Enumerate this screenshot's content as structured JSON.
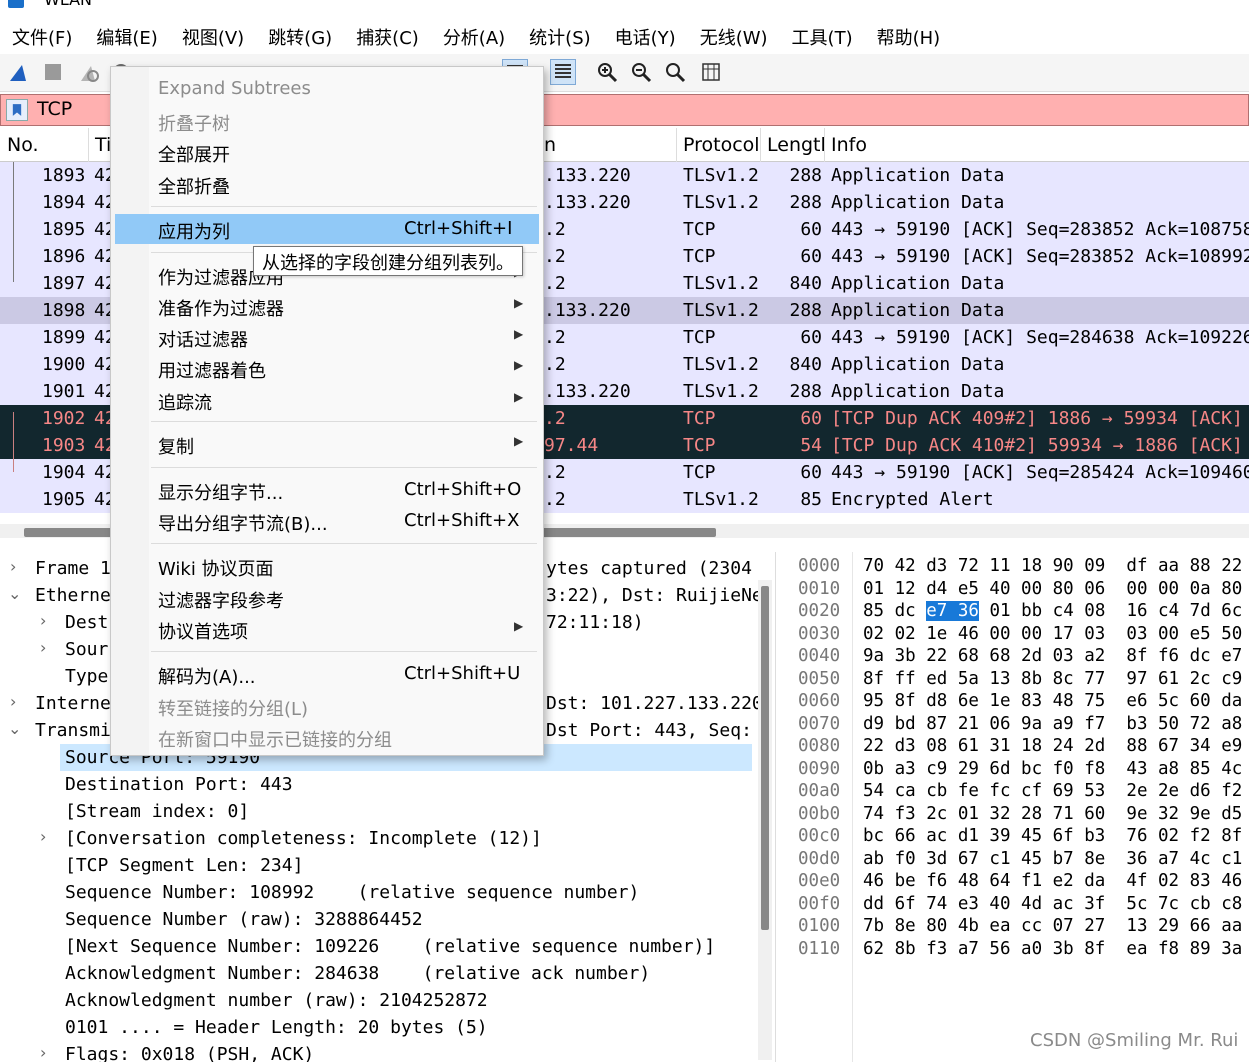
{
  "window": {
    "title": "WLAN"
  },
  "menubar": [
    "文件(F)",
    "编辑(E)",
    "视图(V)",
    "跳转(G)",
    "捕获(C)",
    "分析(A)",
    "统计(S)",
    "电话(Y)",
    "无线(W)",
    "工具(T)",
    "帮助(H)"
  ],
  "filter": {
    "value": "TCP"
  },
  "packet_list": {
    "columns": {
      "no": "No.",
      "time": "Ti",
      "destination": "n",
      "protocol": "Protocol",
      "length": "Lengtl",
      "info": "Info"
    },
    "rows": [
      {
        "no": "1893",
        "time": "42",
        "dst": ".133.220",
        "proto": "TLSv1.2",
        "len": "288",
        "info": "Application Data"
      },
      {
        "no": "1894",
        "time": "42",
        "dst": ".133.220",
        "proto": "TLSv1.2",
        "len": "288",
        "info": "Application Data"
      },
      {
        "no": "1895",
        "time": "42",
        "dst": ".2",
        "proto": "TCP",
        "len": "60",
        "info": "443 → 59190 [ACK] Seq=283852 Ack=108758"
      },
      {
        "no": "1896",
        "time": "42",
        "dst": ".2",
        "proto": "TCP",
        "len": "60",
        "info": "443 → 59190 [ACK] Seq=283852 Ack=108992"
      },
      {
        "no": "1897",
        "time": "42",
        "dst": ".2",
        "proto": "TLSv1.2",
        "len": "840",
        "info": "Application Data"
      },
      {
        "no": "1898",
        "time": "42",
        "dst": ".133.220",
        "proto": "TLSv1.2",
        "len": "288",
        "info": "Application Data"
      },
      {
        "no": "1899",
        "time": "42",
        "dst": ".2",
        "proto": "TCP",
        "len": "60",
        "info": "443 → 59190 [ACK] Seq=284638 Ack=109226"
      },
      {
        "no": "1900",
        "time": "42",
        "dst": ".2",
        "proto": "TLSv1.2",
        "len": "840",
        "info": "Application Data"
      },
      {
        "no": "1901",
        "time": "42",
        "dst": ".133.220",
        "proto": "TLSv1.2",
        "len": "288",
        "info": "Application Data"
      },
      {
        "no": "1902",
        "time": "42",
        "dst": ".2",
        "proto": "TCP",
        "len": "60",
        "info": "[TCP Dup ACK 409#2] 1886 → 59934 [ACK]"
      },
      {
        "no": "1903",
        "time": "42",
        "dst": "97.44",
        "proto": "TCP",
        "len": "54",
        "info": "[TCP Dup ACK 410#2] 59934 → 1886 [ACK]"
      },
      {
        "no": "1904",
        "time": "42",
        "dst": ".2",
        "proto": "TCP",
        "len": "60",
        "info": "443 → 59190 [ACK] Seq=285424 Ack=109460"
      },
      {
        "no": "1905",
        "time": "42",
        "dst": ".2",
        "proto": "TLSv1.2",
        "len": "85",
        "info": "Encrypted Alert"
      }
    ]
  },
  "details": [
    {
      "text": "Frame 1",
      "tail": "ytes captured (2304"
    },
    {
      "text": "Etherne",
      "tail": "3:22), Dst: RuijieNe"
    },
    {
      "text": "Dest",
      "tail": "72:11:18)"
    },
    {
      "text": "Sour",
      "tail": ""
    },
    {
      "text": "Type",
      "tail": ""
    },
    {
      "text": "Interne",
      "tail": "Dst: 101.227.133.220"
    },
    {
      "text": "Transmi",
      "tail": "Dst Port: 443, Seq:"
    },
    {
      "text": "Source Port: 59190",
      "tail": ""
    },
    {
      "text": "Destination Port: 443",
      "tail": ""
    },
    {
      "text": "[Stream index: 0]",
      "tail": ""
    },
    {
      "text": "[Conversation completeness: Incomplete (12)]",
      "tail": ""
    },
    {
      "text": "[TCP Segment Len: 234]",
      "tail": ""
    },
    {
      "text": "Sequence Number: 108992    (relative sequence number)",
      "tail": ""
    },
    {
      "text": "Sequence Number (raw): 3288864452",
      "tail": ""
    },
    {
      "text": "[Next Sequence Number: 109226    (relative sequence number)]",
      "tail": ""
    },
    {
      "text": "Acknowledgment Number: 284638    (relative ack number)",
      "tail": ""
    },
    {
      "text": "Acknowledgment number (raw): 2104252872",
      "tail": ""
    },
    {
      "text": "0101 .... = Header Length: 20 bytes (5)",
      "tail": ""
    },
    {
      "text": "Flags: 0x018 (PSH, ACK)",
      "tail": ""
    }
  ],
  "hex": [
    {
      "off": "0000",
      "b1": "70 42 d3 72 11 18 90 09",
      "b2": "df aa 88 22"
    },
    {
      "off": "0010",
      "b1": "01 12 d4 e5 40 00 80 06",
      "b2": "00 00 0a 80"
    },
    {
      "off": "0020",
      "b1": "85 dc",
      "sel": "e7 36",
      "b1b": "01 bb c4 08",
      "b2": "16 c4 7d 6c"
    },
    {
      "off": "0030",
      "b1": "02 02 1e 46 00 00 17 03",
      "b2": "03 00 e5 50"
    },
    {
      "off": "0040",
      "b1": "9a 3b 22 68 68 2d 03 a2",
      "b2": "8f f6 dc e7"
    },
    {
      "off": "0050",
      "b1": "8f ff ed 5a 13 8b 8c 77",
      "b2": "97 61 2c c9"
    },
    {
      "off": "0060",
      "b1": "95 8f d8 6e 1e 83 48 75",
      "b2": "e6 5c 60 da"
    },
    {
      "off": "0070",
      "b1": "d9 bd 87 21 06 9a a9 f7",
      "b2": "b3 50 72 a8"
    },
    {
      "off": "0080",
      "b1": "22 d3 08 61 31 18 24 2d",
      "b2": "88 67 34 e9"
    },
    {
      "off": "0090",
      "b1": "0b a3 c9 29 6d bc f0 f8",
      "b2": "43 a8 85 4c"
    },
    {
      "off": "00a0",
      "b1": "54 ca cb fe fc cf 69 53",
      "b2": "2e 2e d6 f2"
    },
    {
      "off": "00b0",
      "b1": "74 f3 2c 01 32 28 71 60",
      "b2": "9e 32 9e d5"
    },
    {
      "off": "00c0",
      "b1": "bc 66 ac d1 39 45 6f b3",
      "b2": "76 02 f2 8f"
    },
    {
      "off": "00d0",
      "b1": "ab f0 3d 67 c1 45 b7 8e",
      "b2": "36 a7 4c c1"
    },
    {
      "off": "00e0",
      "b1": "46 be f6 48 64 f1 e2 da",
      "b2": "4f 02 83 46"
    },
    {
      "off": "00f0",
      "b1": "dd 6f 74 e3 40 4d ac 3f",
      "b2": "5c 7c cb c8"
    },
    {
      "off": "0100",
      "b1": "7b 8e 80 4b ea cc 07 27",
      "b2": "13 29 66 aa"
    },
    {
      "off": "0110",
      "b1": "62 8b f3 a7 56 a0 3b 8f",
      "b2": "ea f8 89 3a"
    }
  ],
  "context_menu": {
    "items": [
      {
        "label": "Expand Subtrees",
        "shortcut": "",
        "submenu": false,
        "disabled": true
      },
      {
        "label": "折叠子树",
        "shortcut": "",
        "submenu": false,
        "disabled": true
      },
      {
        "label": "全部展开",
        "shortcut": "",
        "submenu": false,
        "disabled": false
      },
      {
        "label": "全部折叠",
        "shortcut": "",
        "submenu": false,
        "disabled": false
      },
      {
        "label": "应用为列",
        "shortcut": "Ctrl+Shift+I",
        "submenu": false,
        "disabled": false,
        "highlighted": true
      },
      {
        "label": "作为过滤器应用",
        "shortcut": "",
        "submenu": true,
        "disabled": false
      },
      {
        "label": "准备作为过滤器",
        "shortcut": "",
        "submenu": true,
        "disabled": false
      },
      {
        "label": "对话过滤器",
        "shortcut": "",
        "submenu": true,
        "disabled": false
      },
      {
        "label": "用过滤器着色",
        "shortcut": "",
        "submenu": true,
        "disabled": false
      },
      {
        "label": "追踪流",
        "shortcut": "",
        "submenu": true,
        "disabled": false
      },
      {
        "label": "复制",
        "shortcut": "",
        "submenu": true,
        "disabled": false
      },
      {
        "label": "显示分组字节...",
        "shortcut": "Ctrl+Shift+O",
        "submenu": false,
        "disabled": false
      },
      {
        "label": "导出分组字节流(B)...",
        "shortcut": "Ctrl+Shift+X",
        "submenu": false,
        "disabled": false
      },
      {
        "label": "Wiki 协议页面",
        "shortcut": "",
        "submenu": false,
        "disabled": false
      },
      {
        "label": "过滤器字段参考",
        "shortcut": "",
        "submenu": false,
        "disabled": false
      },
      {
        "label": "协议首选项",
        "shortcut": "",
        "submenu": true,
        "disabled": false
      },
      {
        "label": "解码为(A)...",
        "shortcut": "Ctrl+Shift+U",
        "submenu": false,
        "disabled": false
      },
      {
        "label": "转至链接的分组(L)",
        "shortcut": "",
        "submenu": false,
        "disabled": true
      },
      {
        "label": "在新窗口中显示已链接的分组",
        "shortcut": "",
        "submenu": false,
        "disabled": true
      }
    ],
    "tooltip": "从选择的字段创建分组列表列。"
  },
  "watermark": "CSDN @Smiling Mr. Rui",
  "colors": {
    "row_tls": "#e7e6ff",
    "row_selected": "#cbc9e4",
    "row_bad_bg": "#12272e",
    "row_bad_fg": "#f78787",
    "filter_bg": "#ffb0b0",
    "menu_highlight": "#91c9f7",
    "hex_select": "#1879d8"
  }
}
